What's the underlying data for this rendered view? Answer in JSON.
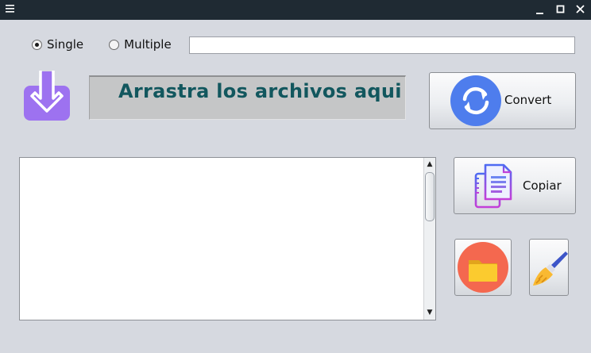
{
  "titlebar": {
    "menu_icon": "hamburger-icon",
    "controls": [
      "minimize-icon",
      "maximize-icon",
      "close-icon"
    ]
  },
  "mode": {
    "options": [
      {
        "label": "Single",
        "selected": true
      },
      {
        "label": "Multiple",
        "selected": false
      }
    ]
  },
  "path_input": {
    "value": "",
    "placeholder": ""
  },
  "drop_zone": {
    "text": "Arrastra los archivos aqui",
    "icon": "download-icon"
  },
  "buttons": {
    "convert": {
      "label": "Convert",
      "icon": "sync-icon"
    },
    "copiar": {
      "label": "Copiar",
      "icon": "copy-documents-icon"
    },
    "folder": {
      "icon": "folder-icon"
    },
    "clean": {
      "icon": "broom-icon"
    }
  },
  "colors": {
    "titlebar": "#1f2a33",
    "background": "#d6d9e0",
    "drop_text": "#12575e",
    "drop_icon": "#9d72f0",
    "convert_icon": "#4e7ded",
    "folder_circle": "#f4684f",
    "folder": "#fbcb2f"
  },
  "output_text": ""
}
